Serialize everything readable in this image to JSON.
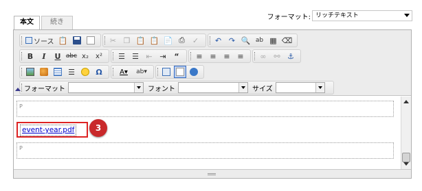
{
  "tabs": [
    {
      "label": "本文",
      "active": true
    },
    {
      "label": "続き",
      "active": false
    }
  ],
  "format_selector": {
    "label": "フォーマット:",
    "value": "リッチテキスト"
  },
  "toolbar": {
    "row1": {
      "source_label": "ソース"
    },
    "row3": {
      "format_label": "フォーマット",
      "format_value": "",
      "font_label": "フォント",
      "font_value": "",
      "size_label": "サイズ",
      "size_value": ""
    }
  },
  "content": {
    "p1": "P",
    "link": "event-year.pdf",
    "p2": "P",
    "badge": "3"
  },
  "icons": [
    "source-icon",
    "paste-icon",
    "save-icon",
    "preview-icon",
    "cut-icon",
    "copy-icon",
    "paste-text-icon",
    "paste-word-icon",
    "print-icon",
    "spellcheck-icon",
    "undo-icon",
    "redo-icon",
    "find-icon",
    "replace-icon",
    "select-all-icon",
    "remove-format-icon",
    "bold-icon",
    "italic-icon",
    "underline-icon",
    "strike-icon",
    "subscript-icon",
    "superscript-icon",
    "numbered-list-icon",
    "bulleted-list-icon",
    "outdent-icon",
    "indent-icon",
    "blockquote-icon",
    "align-left-icon",
    "align-center-icon",
    "align-right-icon",
    "justify-icon",
    "link-icon",
    "unlink-icon",
    "anchor-icon",
    "image-icon",
    "flash-icon",
    "table-icon",
    "horizontal-rule-icon",
    "smiley-icon",
    "special-char-icon",
    "text-color-icon",
    "bg-color-icon",
    "maximize-icon",
    "show-blocks-icon",
    "about-icon"
  ]
}
